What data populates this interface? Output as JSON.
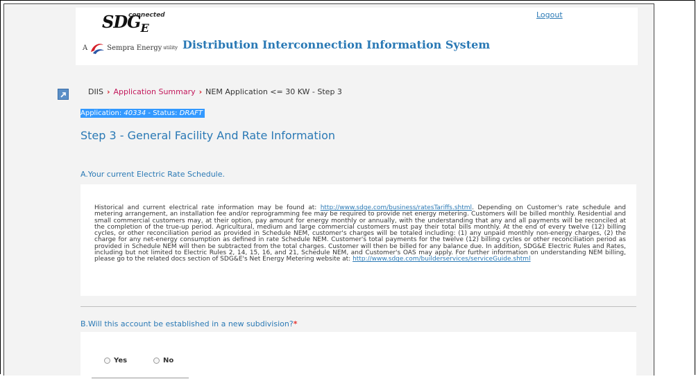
{
  "header": {
    "logo_sdg": "SDG",
    "logo_e": "E",
    "logo_connected": "connected",
    "sempra_prefix": "A",
    "sempra_text": "Sempra Energy",
    "sempra_suffix": "utility",
    "system_title": "Distribution Interconnection Information System",
    "logout_label": "Logout"
  },
  "breadcrumb": {
    "items": [
      "DIIS",
      "Application Summary",
      "NEM Application <= 30 KW - Step 3"
    ]
  },
  "application": {
    "prefix": "Application: ",
    "id": "40334",
    "status_prefix": " - Status: ",
    "status": "DRAFT"
  },
  "step_title": "Step 3 - General Facility And Rate Information",
  "section_a": {
    "title": "A.Your current Electric Rate Schedule.",
    "text_before_link": "Historical and current electrical rate information may be found at: ",
    "link1": "http://www.sdge.com/business/ratesTariffs.shtml",
    "text_middle": ". Depending on Customer's rate schedule and metering arrangement, an installation fee and/or reprogramming fee may be required to provide net energy metering. Customers will be billed monthly. Residential and small commercial customers may, at their option, pay amount for energy monthly or annually, with the understanding that any and all payments will be reconciled at the completion of the true-up period. Agricultural, medium and large commercial customers must pay their total bills monthly. At the end of every twelve (12) billing cycles, or other reconciliation period as provided in Schedule NEM, customer's charges will be totaled including: (1) any unpaid monthly non-energy charges, (2) the charge for any net-energy consumption as defined in rate Schedule NEM. Customer's total payments for the twelve (12) billing cycles or other reconciliation period as provided in Schedule NEM will then be subtracted from the total charges. Customer will then be billed for any balance due. In addition, SDG&E Electric Rules and Rates, including but not limited to Electric Rules 2, 14, 15, 16, and 21, Schedule NEM, and Customer's OAS may apply. For further information on understanding NEM billing, please go to the related docs section of SDG&E's Net Energy Metering website at: ",
    "link2": "http://www.sdge.com/builderservices/serviceGuide.shtml"
  },
  "section_b": {
    "title": "B.Will this account be established in a new subdivision?",
    "required_mark": "*",
    "options": [
      "Yes",
      "No"
    ]
  },
  "colors": {
    "accent_blue": "#2a79b5",
    "selection_blue": "#3399ff",
    "breadcrumb_link": "#c2185b",
    "required_red": "#e53935"
  }
}
